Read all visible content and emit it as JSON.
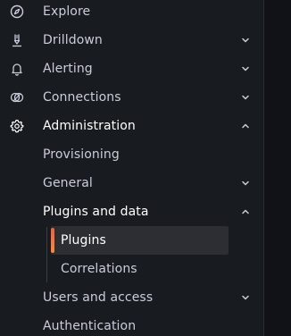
{
  "nav": {
    "items": [
      {
        "label": "Explore",
        "icon": "compass-icon",
        "has_chevron": false
      },
      {
        "label": "Drilldown",
        "icon": "drilldown-icon",
        "has_chevron": true,
        "chevron": "down"
      },
      {
        "label": "Alerting",
        "icon": "bell-icon",
        "has_chevron": true,
        "chevron": "down"
      },
      {
        "label": "Connections",
        "icon": "connections-icon",
        "has_chevron": true,
        "chevron": "down"
      },
      {
        "label": "Administration",
        "icon": "gear-icon",
        "has_chevron": true,
        "chevron": "up",
        "expanded": true
      }
    ],
    "admin_children": [
      {
        "label": "Provisioning"
      },
      {
        "label": "General",
        "chevron": "down"
      },
      {
        "label": "Plugins and data",
        "chevron": "up",
        "expanded": true
      },
      {
        "label": "Users and access",
        "chevron": "down"
      },
      {
        "label": "Authentication"
      }
    ],
    "plugins_children": [
      {
        "label": "Plugins",
        "active": true
      },
      {
        "label": "Correlations"
      }
    ]
  },
  "colors": {
    "background": "#181b1f",
    "text": "#ccccdc",
    "active_text": "#ffffff",
    "accent_start": "#f55f3e",
    "accent_end": "#ff8833",
    "active_bg": "#2c2e33"
  }
}
